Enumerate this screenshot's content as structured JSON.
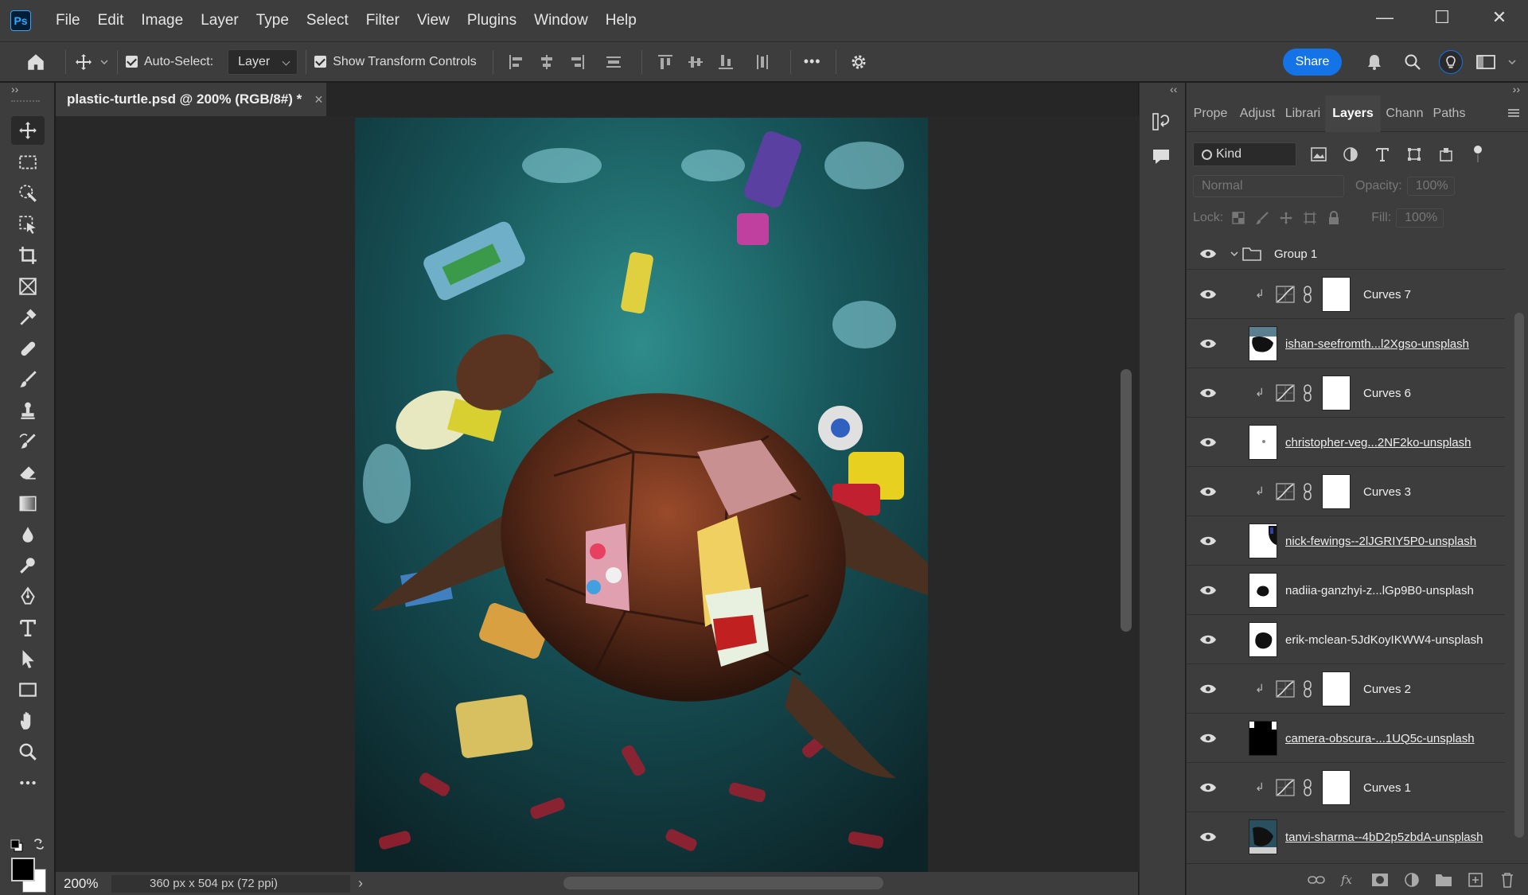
{
  "app": {
    "logo": "Ps",
    "menu": [
      "File",
      "Edit",
      "Image",
      "Layer",
      "Type",
      "Select",
      "Filter",
      "View",
      "Plugins",
      "Window",
      "Help"
    ]
  },
  "window_controls": {
    "minimize": "—",
    "maximize": "☐",
    "close": "✕"
  },
  "options_bar": {
    "auto_select_label": "Auto-Select:",
    "auto_select_target": "Layer",
    "show_transform_label": "Show Transform Controls",
    "more": "•••",
    "share_label": "Share"
  },
  "document": {
    "tab_title": "plastic-turtle.psd @ 200% (RGB/8#) *",
    "close": "×"
  },
  "status": {
    "zoom": "200%",
    "doc_info": "360 px x 504 px (72 ppi)",
    "arrow": "›"
  },
  "panels": {
    "collapse_left": "‹‹",
    "collapse_right": "››",
    "tabs": [
      "Prope",
      "Adjust",
      "Librari",
      "Layers",
      "Chann",
      "Paths"
    ],
    "active_tab": "Layers",
    "filter_kind": "Kind",
    "blend_mode": "Normal",
    "opacity_label": "Opacity:",
    "opacity_value": "100%",
    "lock_label": "Lock:",
    "fill_label": "Fill:",
    "fill_value": "100%"
  },
  "layers": [
    {
      "name": "Group 1",
      "type": "group"
    },
    {
      "name": "Curves 7",
      "type": "adjustment"
    },
    {
      "name": "ishan-seefromth...l2Xgso-unsplash",
      "type": "image",
      "thumb": "dark-blob"
    },
    {
      "name": "Curves 6",
      "type": "adjustment"
    },
    {
      "name": "christopher-veg...2NF2ko-unsplash",
      "type": "image",
      "thumb": "transparent"
    },
    {
      "name": "Curves 3",
      "type": "adjustment"
    },
    {
      "name": "nick-fewings--2lJGRIY5P0-unsplash",
      "type": "image",
      "thumb": "edge"
    },
    {
      "name": "nadiia-ganzhyi-z...lGp9B0-unsplash",
      "type": "image",
      "thumb": "small-blob"
    },
    {
      "name": "erik-mclean-5JdKoyIKWW4-unsplash",
      "type": "image",
      "thumb": "blob"
    },
    {
      "name": "Curves 2",
      "type": "adjustment"
    },
    {
      "name": "camera-obscura-...1UQ5c-unsplash",
      "type": "image",
      "thumb": "black"
    },
    {
      "name": "Curves 1",
      "type": "adjustment"
    },
    {
      "name": "tanvi-sharma--4bD2p5zbdA-unsplash",
      "type": "image",
      "thumb": "photo"
    }
  ],
  "colors": {
    "accent": "#1473e6",
    "panel_bg": "#3d3d3d",
    "canvas_bg": "#282828",
    "foreground": "#000000",
    "background": "#ffffff"
  }
}
